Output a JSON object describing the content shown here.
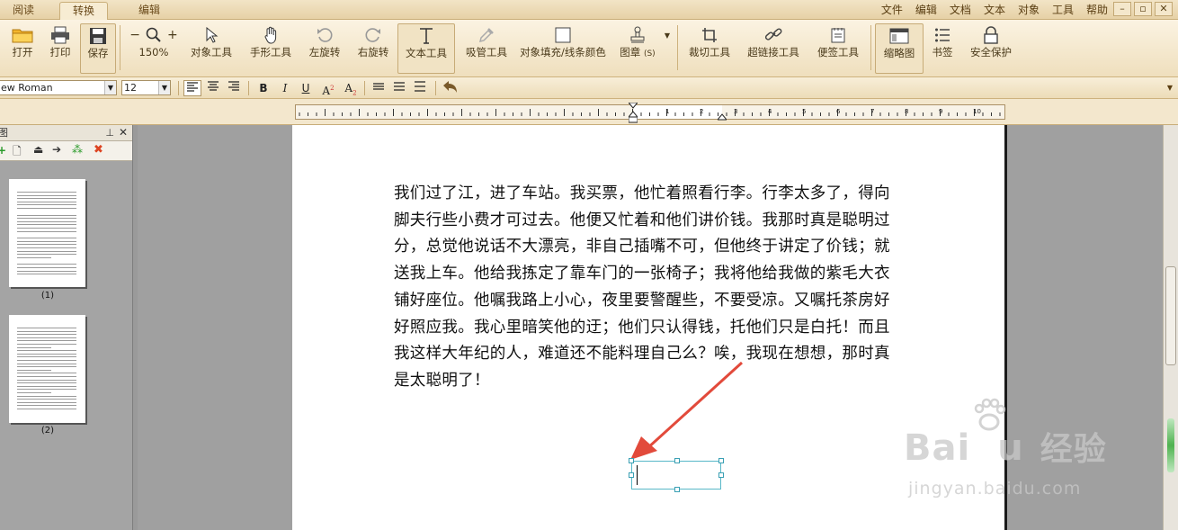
{
  "tabs": [
    {
      "label": "阅读",
      "active": false
    },
    {
      "label": "转换",
      "active": true
    },
    {
      "label": "编辑",
      "active": false
    }
  ],
  "menus": [
    "文件",
    "编辑",
    "文档",
    "文本",
    "对象",
    "工具",
    "帮助"
  ],
  "toolbar": {
    "open": "打开",
    "print": "打印",
    "save": "保存",
    "zoom": "150%",
    "object_tool": "对象工具",
    "hand_tool": "手形工具",
    "rotate_left": "左旋转",
    "rotate_right": "右旋转",
    "text_tool": "文本工具",
    "eyedropper_tool": "吸管工具",
    "fill_stroke_color": "对象填充/线条颜色",
    "stamp": "图章",
    "stamp_shortcut": "(S)",
    "crop_tool": "裁切工具",
    "hyperlink_tool": "超链接工具",
    "note_tool": "便签工具",
    "thumbnail": "缩略图",
    "bookmark": "书签",
    "security": "安全保护"
  },
  "format": {
    "font_name": "ew Roman",
    "font_size": "12"
  },
  "ruler_numbers": [
    "1",
    "2",
    "3",
    "4",
    "5",
    "6",
    "7",
    "8",
    "9",
    "10"
  ],
  "left_panel": {
    "title": "图",
    "pages": [
      {
        "label": "(1)"
      },
      {
        "label": "(2)"
      }
    ]
  },
  "document": {
    "lines": [
      "我们过了江，进了车站。我买票，他忙着照看行李。行李太多了，得向",
      "脚夫行些小费才可过去。他便又忙着和他们讲价钱。我那时真是聪明过",
      "分，总觉他说话不大漂亮，非自己插嘴不可，但他终于讲定了价钱；就",
      "送我上车。他给我拣定了靠车门的一张椅子；我将他给我做的紫毛大衣",
      "铺好座位。他嘱我路上小心，夜里要警醒些，不要受凉。又嘱托茶房好",
      "好照应我。我心里暗笑他的迂；他们只认得钱，托他们只是白托！而且",
      "我这样大年纪的人，难道还不能料理自己么？唉，我现在想想，那时真",
      "是太聪明了！"
    ]
  },
  "watermark": {
    "brand": "Bai",
    "brand_tail": "u",
    "cn": "经验",
    "url": "jingyan.baidu.com"
  },
  "colors": {
    "accent": "#e24a3b",
    "textbox_border": "#58b8c8"
  }
}
